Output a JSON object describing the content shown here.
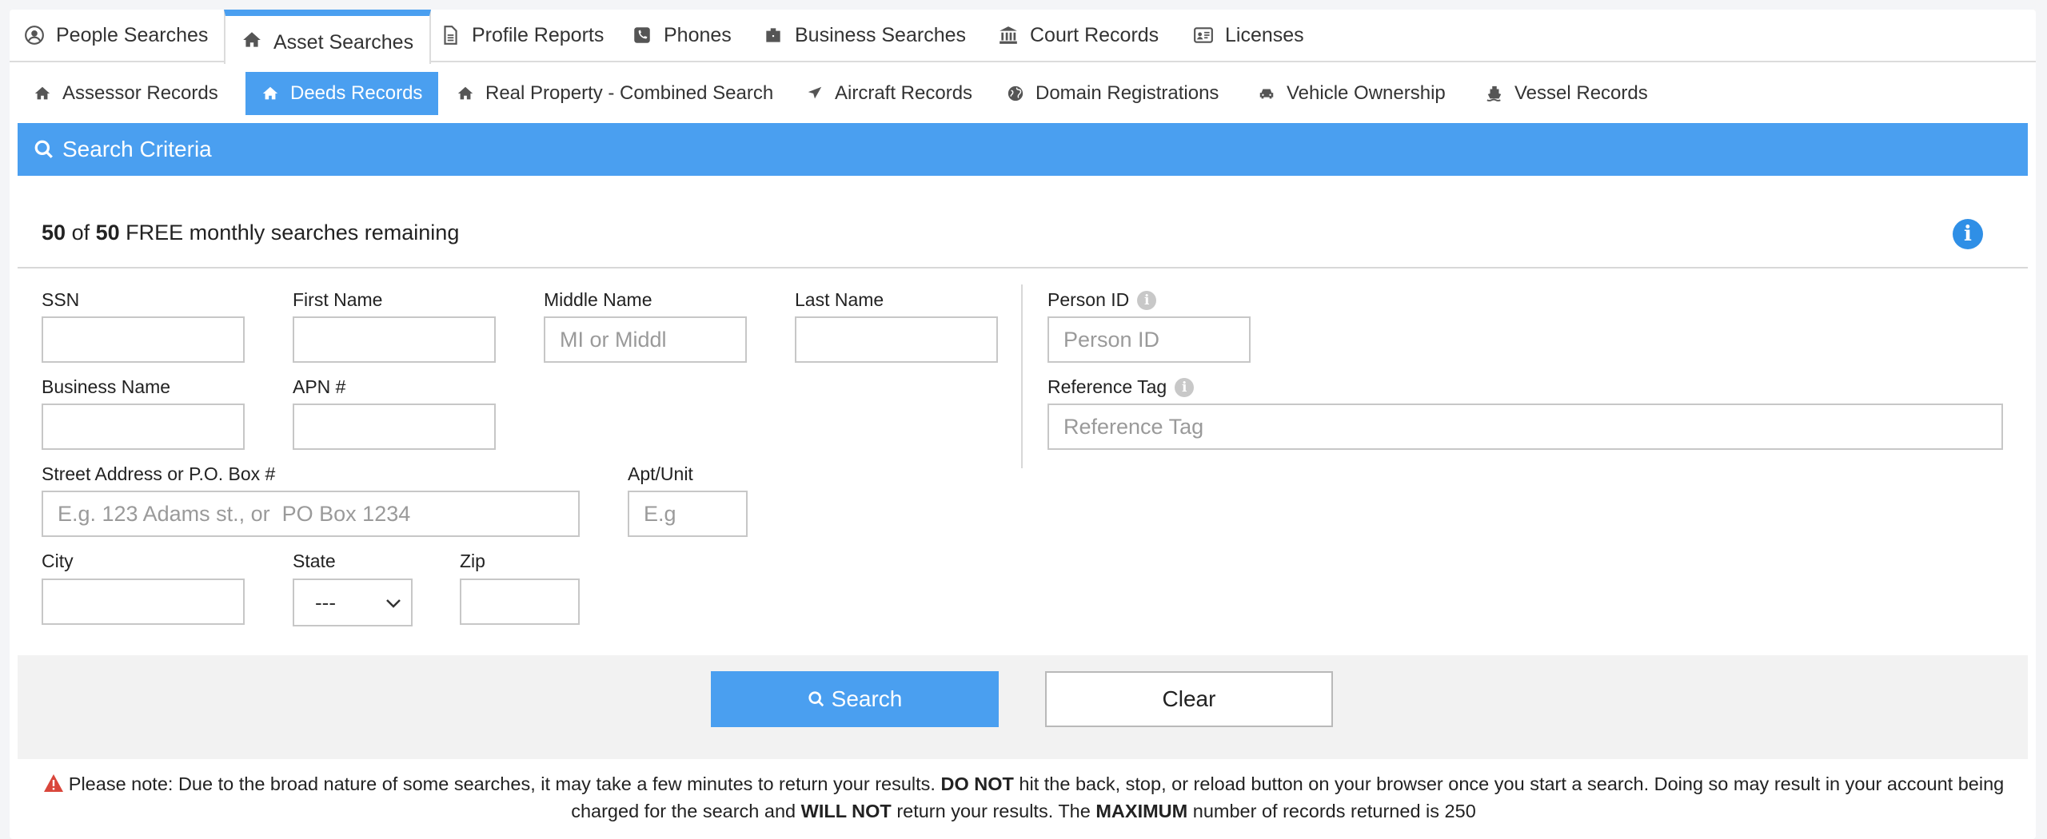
{
  "top_tabs": [
    {
      "label": "People Searches",
      "icon": "user-circle-icon"
    },
    {
      "label": "Asset Searches",
      "icon": "home-icon",
      "active": true
    },
    {
      "label": "Profile Reports",
      "icon": "document-icon"
    },
    {
      "label": "Phones",
      "icon": "phone-icon"
    },
    {
      "label": "Business Searches",
      "icon": "briefcase-icon"
    },
    {
      "label": "Court Records",
      "icon": "courthouse-icon"
    },
    {
      "label": "Licenses",
      "icon": "id-card-icon"
    }
  ],
  "sub_tabs": [
    {
      "label": "Assessor Records",
      "icon": "home-icon"
    },
    {
      "label": "Deeds Records",
      "icon": "home-icon",
      "active": true
    },
    {
      "label": "Real Property - Combined Search",
      "icon": "home-icon"
    },
    {
      "label": "Aircraft Records",
      "icon": "plane-icon"
    },
    {
      "label": "Domain Registrations",
      "icon": "globe-icon"
    },
    {
      "label": "Vehicle Ownership",
      "icon": "car-icon"
    },
    {
      "label": "Vessel Records",
      "icon": "ship-icon"
    }
  ],
  "criteria": {
    "title": "Search Criteria"
  },
  "quota": {
    "used": "50",
    "of": "of",
    "total": "50",
    "suffix": "FREE monthly searches remaining"
  },
  "fields": {
    "ssn": {
      "label": "SSN",
      "value": "",
      "placeholder": ""
    },
    "first_name": {
      "label": "First Name",
      "value": "",
      "placeholder": ""
    },
    "middle_name": {
      "label": "Middle Name",
      "value": "",
      "placeholder": "MI or Middl"
    },
    "last_name": {
      "label": "Last Name",
      "value": "",
      "placeholder": ""
    },
    "person_id": {
      "label": "Person ID",
      "value": "",
      "placeholder": "Person ID"
    },
    "business_name": {
      "label": "Business Name",
      "value": "",
      "placeholder": ""
    },
    "apn": {
      "label": "APN #",
      "value": "",
      "placeholder": ""
    },
    "reference_tag": {
      "label": "Reference Tag",
      "value": "",
      "placeholder": "Reference Tag"
    },
    "street": {
      "label": "Street Address or P.O. Box #",
      "value": "",
      "placeholder": "E.g. 123 Adams st., or  PO Box 1234"
    },
    "apt": {
      "label": "Apt/Unit",
      "value": "",
      "placeholder": "E.g"
    },
    "city": {
      "label": "City",
      "value": "",
      "placeholder": ""
    },
    "state": {
      "label": "State",
      "selected": "---"
    },
    "zip": {
      "label": "Zip",
      "value": "",
      "placeholder": ""
    }
  },
  "actions": {
    "search": "Search",
    "clear": "Clear"
  },
  "note": {
    "p1": "Please note: Due to the broad nature of some searches, it may take a few minutes to return your results.",
    "b1": "DO NOT",
    "p2": "hit the back, stop, or reload button on your browser once you start a search. Doing so may result in your account being charged for the search and",
    "b2": "WILL NOT",
    "p3": "return your results. The",
    "b3": "MAXIMUM",
    "p4": "number of records returned is 250"
  },
  "colors": {
    "accent": "#4a9ff0",
    "info": "#2f8fe6",
    "warning": "#d9463b"
  }
}
